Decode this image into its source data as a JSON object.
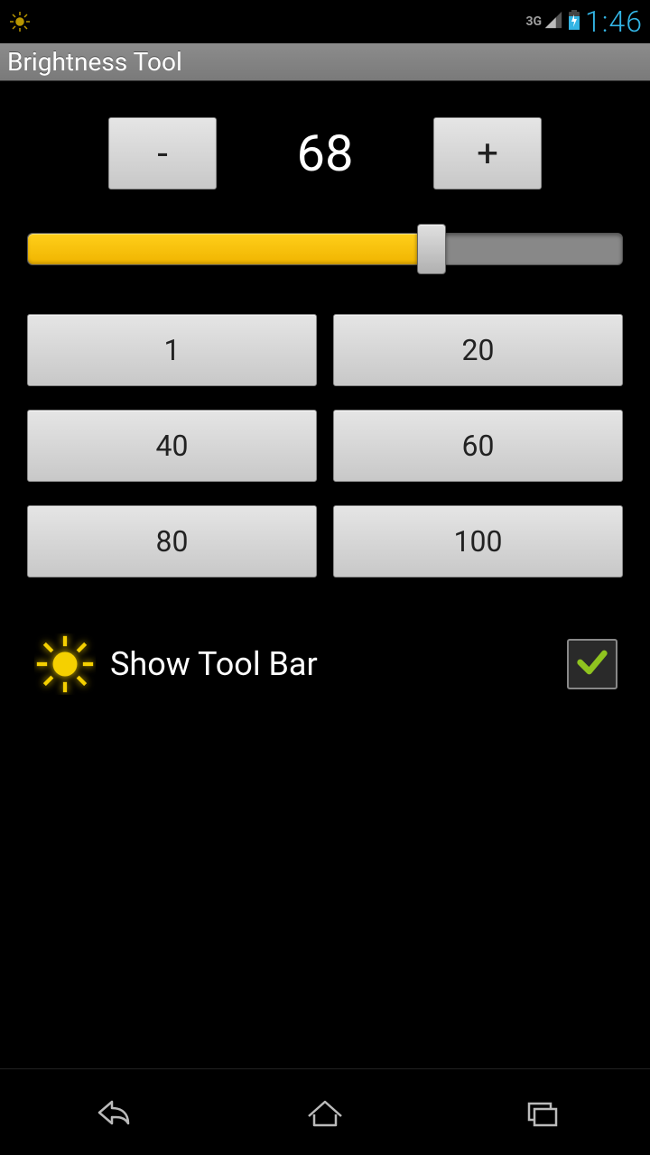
{
  "status_bar": {
    "network_label": "3G",
    "clock": "1:46",
    "colors": {
      "clock": "#33b5e5",
      "icons": "#9e9e9e"
    }
  },
  "title_bar": {
    "title": "Brightness Tool"
  },
  "brightness": {
    "minus_label": "-",
    "plus_label": "+",
    "current_value": "68",
    "slider_min": 0,
    "slider_max": 100,
    "slider_value": 68,
    "accent_color": "#f0b400"
  },
  "presets": [
    {
      "label": "1",
      "value": 1
    },
    {
      "label": "20",
      "value": 20
    },
    {
      "label": "40",
      "value": 40
    },
    {
      "label": "60",
      "value": 60
    },
    {
      "label": "80",
      "value": 80
    },
    {
      "label": "100",
      "value": 100
    }
  ],
  "toolbar_option": {
    "label": "Show Tool Bar",
    "checked": true,
    "check_color": "#8fc31f"
  },
  "nav": {
    "back": "back",
    "home": "home",
    "recent": "recent"
  }
}
